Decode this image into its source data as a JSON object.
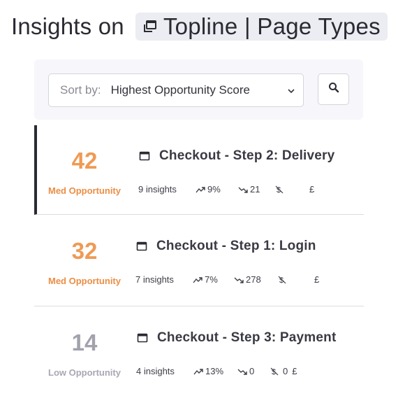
{
  "header": {
    "title": "Insights on",
    "scope": "Topline | Page Types",
    "scope_icon": "window-stack-icon"
  },
  "sort": {
    "label": "Sort by:",
    "value": "Highest Opportunity Score"
  },
  "rows": [
    {
      "score": "42",
      "opportunity": "Med Opportunity",
      "title": "Checkout - Step 2: Delivery",
      "insights": "9 insights",
      "trend_up": "9%",
      "trend_down": "21",
      "revenue": "",
      "currency": "£"
    },
    {
      "score": "32",
      "opportunity": "Med Opportunity",
      "title": "Checkout - Step 1: Login",
      "insights": "7 insights",
      "trend_up": "7%",
      "trend_down": "278",
      "revenue": "",
      "currency": "£"
    },
    {
      "score": "14",
      "opportunity": "Low Opportunity",
      "title": "Checkout - Step 3: Payment",
      "insights": "4 insights",
      "trend_up": "13%",
      "trend_down": "0",
      "revenue": "0",
      "currency": "£"
    }
  ],
  "colors": {
    "med": "#ef9a55",
    "low": "#a2a2ad",
    "selected_bar": "#2a2a33"
  }
}
